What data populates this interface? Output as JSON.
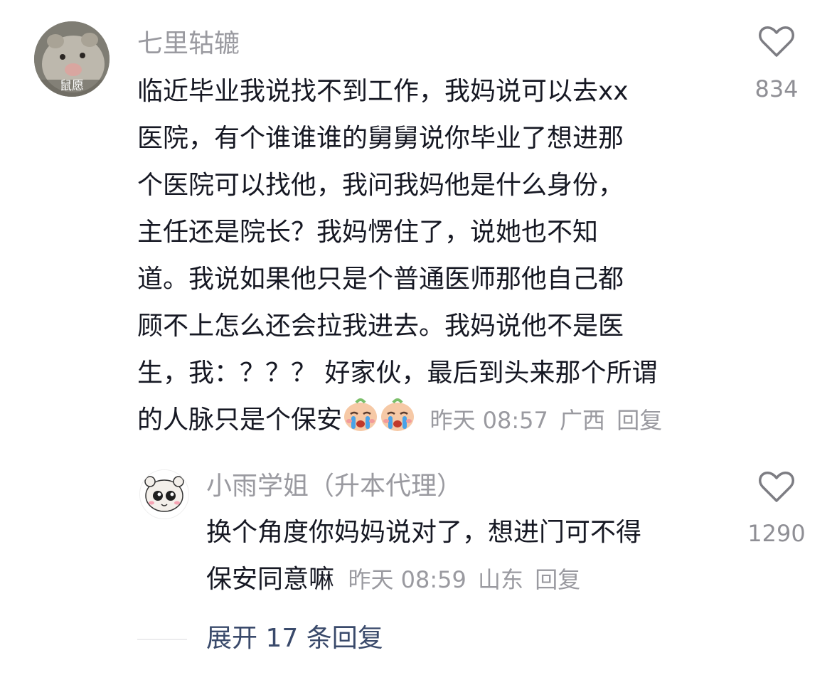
{
  "comments": [
    {
      "username": "七里轱辘",
      "avatar_badge": "鼠愿",
      "lines": [
        "临近毕业我说找不到工作，我妈说可以去xx",
        "医院，有个谁谁谁的舅舅说你毕业了想进那",
        "个医院可以找他，我问我妈他是什么身份，",
        "主任还是院长？我妈愣住了，说她也不知",
        "道。我说如果他只是个普通医师那他自己都",
        "顾不上怎么还会拉我进去。我妈说他不是医",
        "生，我：？？？ 好家伙，最后到头来那个所谓",
        "的人脉只是个保安"
      ],
      "emoji": "loudly-crying-emoji",
      "time": "昨天 08:57",
      "location": "广西",
      "reply_label": "回复",
      "like_icon": "heart-outline-icon",
      "like_count": "834"
    },
    {
      "username": "小雨学姐（升本代理）",
      "lines": [
        "换个角度你妈妈说对了，想进门可不得",
        "保安同意嘛"
      ],
      "time": "昨天 08:59",
      "location": "山东",
      "reply_label": "回复",
      "like_icon": "heart-outline-icon",
      "like_count": "1290"
    }
  ],
  "expand_replies": "展开 17 条回复"
}
